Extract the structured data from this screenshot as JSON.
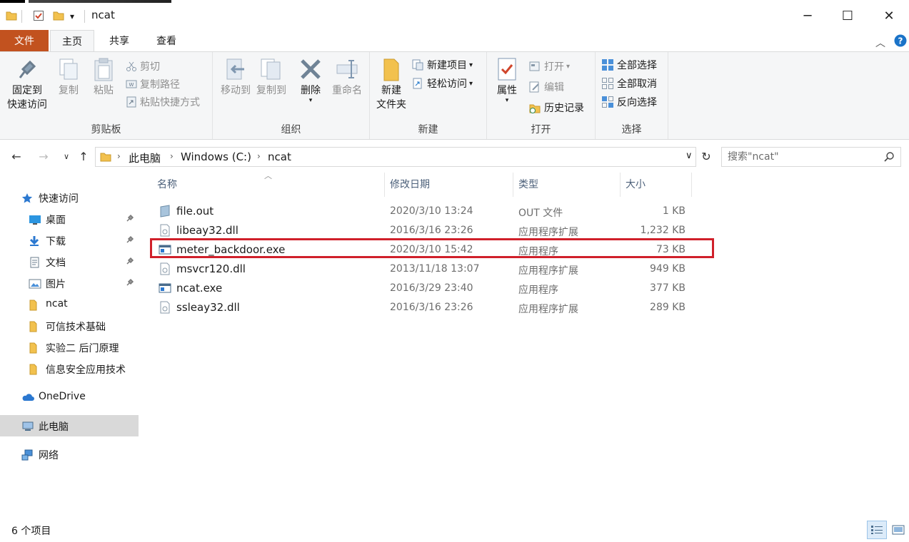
{
  "window": {
    "title": "ncat",
    "controls": {
      "minimize": "─",
      "maximize": "☐",
      "close": "✕"
    }
  },
  "ribbon_tabs": [
    "文件",
    "主页",
    "共享",
    "查看"
  ],
  "ribbon": {
    "clipboard": {
      "label": "剪贴板",
      "pin_line1": "固定到",
      "pin_line2": "快速访问",
      "copy": "复制",
      "paste": "粘贴",
      "cut": "剪切",
      "copy_path": "复制路径",
      "paste_shortcut": "粘贴快捷方式"
    },
    "organize": {
      "label": "组织",
      "move_to": "移动到",
      "copy_to": "复制到",
      "delete": "删除",
      "rename": "重命名"
    },
    "new": {
      "label": "新建",
      "new_folder_line1": "新建",
      "new_folder_line2": "文件夹",
      "new_item": "新建项目",
      "easy_access": "轻松访问"
    },
    "open": {
      "label": "打开",
      "properties": "属性",
      "open": "打开",
      "edit": "编辑",
      "history": "历史记录"
    },
    "select": {
      "label": "选择",
      "select_all": "全部选择",
      "select_none": "全部取消",
      "invert": "反向选择"
    }
  },
  "address": {
    "crumbs": [
      "此电脑",
      "Windows (C:)",
      "ncat"
    ]
  },
  "search": {
    "placeholder": "搜索\"ncat\""
  },
  "nav_pane": {
    "quick_access": "快速访问",
    "items": [
      {
        "label": "桌面",
        "pinned": true
      },
      {
        "label": "下载",
        "pinned": true
      },
      {
        "label": "文档",
        "pinned": true
      },
      {
        "label": "图片",
        "pinned": true
      },
      {
        "label": "ncat",
        "pinned": false
      },
      {
        "label": "可信技术基础",
        "pinned": false
      },
      {
        "label": "实验二 后门原理",
        "pinned": false
      },
      {
        "label": "信息安全应用技术",
        "pinned": false
      }
    ],
    "onedrive": "OneDrive",
    "this_pc": "此电脑",
    "network": "网络"
  },
  "columns": {
    "name": "名称",
    "modified": "修改日期",
    "type": "类型",
    "size": "大小"
  },
  "files": [
    {
      "name": "file.out",
      "modified": "2020/3/10 13:24",
      "type": "OUT 文件",
      "size": "1 KB"
    },
    {
      "name": "libeay32.dll",
      "modified": "2016/3/16 23:26",
      "type": "应用程序扩展",
      "size": "1,232 KB"
    },
    {
      "name": "meter_backdoor.exe",
      "modified": "2020/3/10 15:42",
      "type": "应用程序",
      "size": "73 KB"
    },
    {
      "name": "msvcr120.dll",
      "modified": "2013/11/18 13:07",
      "type": "应用程序扩展",
      "size": "949 KB"
    },
    {
      "name": "ncat.exe",
      "modified": "2016/3/29 23:40",
      "type": "应用程序",
      "size": "377 KB"
    },
    {
      "name": "ssleay32.dll",
      "modified": "2016/3/16 23:26",
      "type": "应用程序扩展",
      "size": "289 KB"
    }
  ],
  "status": {
    "count": "6 个项目"
  },
  "colors": {
    "file_tab": "#c2521f",
    "highlight": "#d0202a",
    "folder": "#f2c14e",
    "accent": "#1a73c8"
  }
}
